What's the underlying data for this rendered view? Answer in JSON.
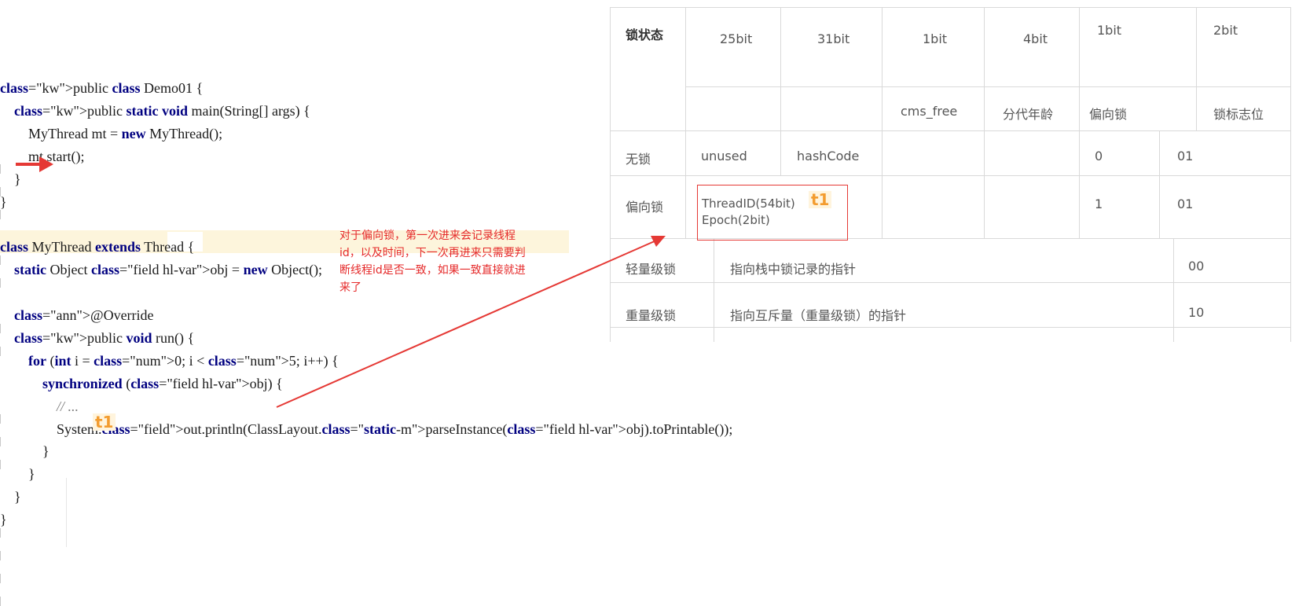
{
  "code": {
    "lines": [
      "public class Demo01 {",
      "    public static void main(String[] args) {",
      "        MyThread mt = new MyThread();",
      "        mt.start();",
      "    }",
      "}",
      "",
      "class MyThread extends Thread {",
      "    static Object obj = new Object();",
      "",
      "    @Override",
      "    public void run() {",
      "        for (int i = 0; i < 5; i++) {",
      "            synchronized (obj) {",
      "                // ...",
      "                System.out.println(ClassLayout.parseInstance(obj).toPrintable());",
      "            }",
      "        }",
      "    }",
      "}"
    ],
    "marker": "t1"
  },
  "annotation": "对于偏向锁，第一次进来会记录线程id，以及时间，下一次再进来只需要判断线程id是否一致，如果一致直接就进来了",
  "table": {
    "header_label": "锁状态",
    "bit_widths": [
      "25bit",
      "31bit",
      "1bit",
      "4bit",
      "1bit",
      "2bit"
    ],
    "field_names": [
      "",
      "",
      "cms_free",
      "分代年龄",
      "偏向锁",
      "锁标志位"
    ],
    "rows": [
      {
        "state": "无锁",
        "c1": "unused",
        "c2": "hashCode",
        "biased": "0",
        "flag": "01"
      },
      {
        "state": "偏向锁",
        "c1_line1": "ThreadID(54bit)",
        "c1_line2": "Epoch(2bit)",
        "marker": "t1",
        "biased": "1",
        "flag": "01"
      },
      {
        "state": "轻量级锁",
        "content": "指向栈中锁记录的指针",
        "flag": "00"
      },
      {
        "state": "重量级锁",
        "content": "指向互斥量（重量级锁）的指针",
        "flag": "10"
      }
    ]
  },
  "colors": {
    "arrow": "#e53935",
    "marker": "#f39c2f",
    "annotation": "#e52a2a",
    "current_line": "#fdf5dc"
  }
}
